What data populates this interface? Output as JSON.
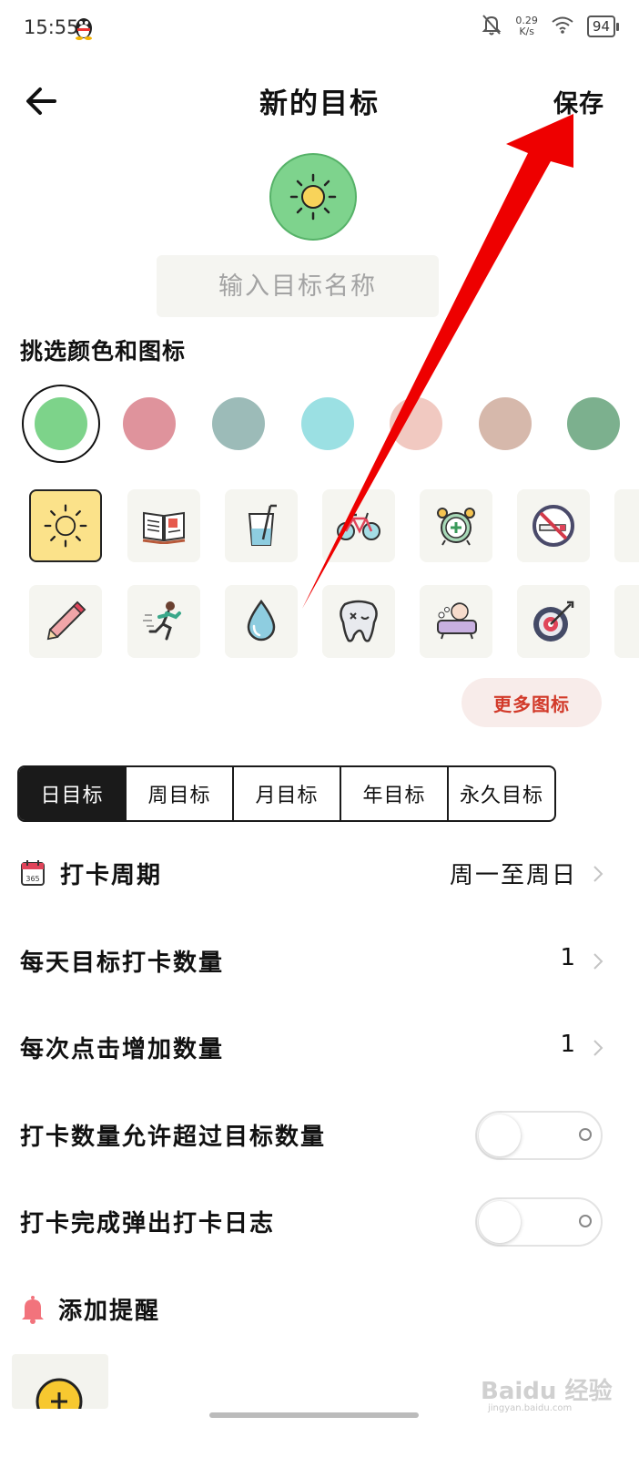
{
  "status": {
    "time": "15:55",
    "net_speed": "0.29",
    "net_unit": "K/s",
    "battery": "94"
  },
  "header": {
    "title": "新的目标",
    "save_label": "保存"
  },
  "goal_name": {
    "placeholder": "输入目标名称",
    "value": ""
  },
  "picker": {
    "label": "挑选颜色和图标",
    "more_icons_label": "更多图标"
  },
  "colors": [
    "#7dd38a",
    "#df939c",
    "#9cbbb8",
    "#9be0e3",
    "#f1c9c1",
    "#d6b8ab",
    "#7cb08e"
  ],
  "selected_color": "#7dd38a",
  "icon_rows": [
    [
      "sun-icon",
      "book-icon",
      "drink-glass-icon",
      "bicycle-icon",
      "alarm-clock-icon",
      "no-smoking-icon"
    ],
    [
      "pencil-icon",
      "running-person-icon",
      "water-drop-icon",
      "tooth-icon",
      "bath-tub-icon",
      "target-icon"
    ]
  ],
  "selected_icon": "sun-icon",
  "tabs": [
    "日目标",
    "周目标",
    "月目标",
    "年目标",
    "永久目标"
  ],
  "active_tab": "日目标",
  "settings": {
    "period_label": "打卡周期",
    "period_value": "周一至周日",
    "daily_target_label": "每天目标打卡数量",
    "daily_target_value": "1",
    "increment_label": "每次点击增加数量",
    "increment_value": "1",
    "allow_exceed_label": "打卡数量允许超过目标数量",
    "allow_exceed_on": false,
    "popup_log_label": "打卡完成弹出打卡日志",
    "popup_log_on": false,
    "reminder_label": "添加提醒"
  },
  "watermark": {
    "text": "Baidu 经验",
    "sub": "jingyan.baidu.com"
  }
}
